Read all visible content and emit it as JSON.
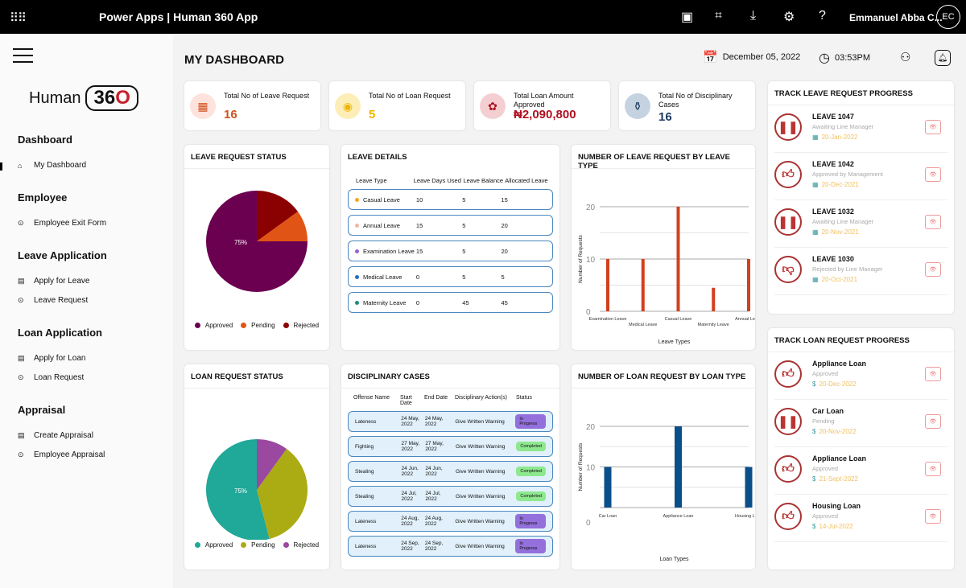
{
  "topbar": {
    "app_title": "Power Apps | Human 360 App",
    "user_name": "Emmanuel Abba C...",
    "avatar_initials": "EC",
    "icons": [
      "waffle-icon",
      "teams-icon",
      "fit-screen-icon",
      "download-icon",
      "settings-icon",
      "help-icon"
    ]
  },
  "sidebar": {
    "logo_text": "Human",
    "logo_badge": "36",
    "logo_badge_accent": "O",
    "sections": [
      {
        "title": "Dashboard",
        "items": [
          {
            "label": "My Dashboard",
            "icon": "home-icon"
          }
        ]
      },
      {
        "title": "Employee",
        "items": [
          {
            "label": "Employee Exit Form",
            "icon": "circle-dots-icon"
          }
        ]
      },
      {
        "title": "Leave Application",
        "items": [
          {
            "label": "Apply for Leave",
            "icon": "form-icon"
          },
          {
            "label": "Leave Request",
            "icon": "circle-dots-icon"
          }
        ]
      },
      {
        "title": "Loan Application",
        "items": [
          {
            "label": "Apply for Loan",
            "icon": "form-icon"
          },
          {
            "label": "Loan Request",
            "icon": "circle-dots-icon"
          }
        ]
      },
      {
        "title": "Appraisal",
        "items": [
          {
            "label": "Create Appraisal",
            "icon": "form-icon"
          },
          {
            "label": "Employee Appraisal",
            "icon": "circle-dots-icon"
          }
        ]
      }
    ]
  },
  "header": {
    "title": "MY DASHBOARD",
    "date": "December 05, 2022",
    "time": "03:53PM"
  },
  "kpis": [
    {
      "label": "Total No of Leave Request",
      "value": "16",
      "color": "#d2501e",
      "bg": "#fde3dc",
      "icon": "leave-icon"
    },
    {
      "label": "Total No of Loan Request",
      "value": "5",
      "color": "#f0b400",
      "bg": "#fdeeb8",
      "icon": "loan-icon"
    },
    {
      "label": "Total Loan Amount Approved",
      "value": "₦2,090,800",
      "color": "#b01020",
      "bg": "#f4cfd2",
      "icon": "money-icon"
    },
    {
      "label": "Total No of Disciplinary Cases",
      "value": "16",
      "color": "#1d3a5f",
      "bg": "#c5d3e0",
      "icon": "discipline-icon"
    }
  ],
  "leave_status": {
    "title": "LEAVE REQUEST STATUS"
  },
  "loan_status": {
    "title": "LOAN REQUEST STATUS"
  },
  "leave_details": {
    "title": "LEAVE DETAILS",
    "columns": [
      "Leave Type",
      "Leave Days Used",
      "Leave Balance",
      "Allocated Leave"
    ],
    "rows": [
      {
        "type": "Casual Leave",
        "used": "10",
        "balance": "5",
        "allocated": "15",
        "dot": "#f5a623"
      },
      {
        "type": "Annual Leave",
        "used": "15",
        "balance": "5",
        "allocated": "20",
        "dot": "#f2b8a0"
      },
      {
        "type": "Examination Leave",
        "used": "15",
        "balance": "5",
        "allocated": "20",
        "dot": "#9466d0"
      },
      {
        "type": "Medical Leave",
        "used": "0",
        "balance": "5",
        "allocated": "5",
        "dot": "#1f6fc0"
      },
      {
        "type": "Maternity Leave",
        "used": "0",
        "balance": "45",
        "allocated": "45",
        "dot": "#1e8a80"
      }
    ]
  },
  "disciplinary": {
    "title": "DISCIPLINARY CASES",
    "columns": [
      "Offense Name",
      "Start Date",
      "End Date",
      "Disciplinary Action(s)",
      "Status"
    ],
    "rows": [
      {
        "offense": "Lateness",
        "start": "24 May, 2022",
        "end": "24 May, 2022",
        "action": "Give Written Warning",
        "status": "In Progress"
      },
      {
        "offense": "Fighting",
        "start": "27 May, 2022",
        "end": "27 May, 2022",
        "action": "Give Written Warning",
        "status": "Completed"
      },
      {
        "offense": "Stealing",
        "start": "24 Jun, 2022",
        "end": "24 Jun, 2022",
        "action": "Give Written Warning",
        "status": "Completed"
      },
      {
        "offense": "Stealing",
        "start": "24 Jul, 2022",
        "end": "24 Jul, 2022",
        "action": "Give Written Warning",
        "status": "Completed"
      },
      {
        "offense": "Lateness",
        "start": "24 Aug, 2022",
        "end": "24 Aug, 2022",
        "action": "Give Written Warning",
        "status": "In Progress"
      },
      {
        "offense": "Lateness",
        "start": "24 Sep, 2022",
        "end": "24 Sep, 2022",
        "action": "Give Written Warning",
        "status": "In Progress"
      }
    ],
    "status_colors": {
      "In Progress": "#9370db",
      "Completed": "#8ee88e"
    }
  },
  "leave_track": {
    "title": "TRACK LEAVE REQUEST PROGRESS",
    "items": [
      {
        "name": "LEAVE 1047",
        "status": "Awaiting Line Manager",
        "date": "20-Jan-2022",
        "icon": "pause-icon"
      },
      {
        "name": "LEAVE 1042",
        "status": "Approved by Management",
        "date": "20-Dec-2021",
        "icon": "thumbs-up-icon"
      },
      {
        "name": "LEAVE 1032",
        "status": "Awaiting Line Manager",
        "date": "20-Nov-2021",
        "icon": "pause-icon"
      },
      {
        "name": "LEAVE 1030",
        "status": "Rejected by Line Manager",
        "date": "20-Oct-2021",
        "icon": "thumbs-down-icon"
      }
    ]
  },
  "loan_track": {
    "title": "TRACK LOAN REQUEST PROGRESS",
    "items": [
      {
        "name": "Appliance Loan",
        "status": "Approved",
        "date": "20-Dec-2022",
        "icon": "thumbs-up-icon"
      },
      {
        "name": "Car Loan",
        "status": "Pending",
        "date": "20-Nov-2022",
        "icon": "pause-icon"
      },
      {
        "name": "Appliance Loan",
        "status": "Approved",
        "date": "21-Sept-2022",
        "icon": "thumbs-up-icon"
      },
      {
        "name": "Housing Loan",
        "status": "Approved",
        "date": "14-Jul-2022",
        "icon": "thumbs-up-icon"
      }
    ]
  },
  "chart_data": [
    {
      "type": "pie",
      "title": "LEAVE REQUEST STATUS",
      "categories": [
        "Approved",
        "Pending",
        "Rejected"
      ],
      "values": [
        75,
        10,
        15
      ],
      "colors": [
        "#6b0050",
        "#e05515",
        "#8b0000"
      ],
      "slice_label": "75%",
      "legend": "bottom"
    },
    {
      "type": "pie",
      "title": "LOAN REQUEST STATUS",
      "categories": [
        "Approved",
        "Pending",
        "Rejected"
      ],
      "values": [
        54,
        36,
        10
      ],
      "colors": [
        "#20a898",
        "#abab14",
        "#9a48a0"
      ],
      "slice_label": "75%",
      "legend": "bottom"
    },
    {
      "type": "bar",
      "title": "NUMBER OF LEAVE REQUEST BY LEAVE TYPE",
      "categories": [
        "Examination Leave",
        "Medical Leave",
        "Casual Leave",
        "Maternity Leave",
        "Annual Leave"
      ],
      "values": [
        10,
        10,
        20,
        4.5,
        10
      ],
      "xlabel": "Leave Types",
      "ylabel": "Number of Requests",
      "ylim": [
        0,
        20
      ],
      "yticks": [
        "0",
        "10",
        "20"
      ],
      "color": "#d2401e",
      "grid": true
    },
    {
      "type": "bar",
      "title": "NUMBER OF LOAN REQUEST BY LOAN TYPE",
      "categories": [
        "Car Loan",
        "Appliance Loan",
        "Housing Loan"
      ],
      "values": [
        10,
        20,
        10
      ],
      "xlabel": "Loan Types",
      "ylabel": "Number of Requests",
      "ylim": [
        0,
        20
      ],
      "yticks": [
        "0",
        "10",
        "20"
      ],
      "color": "#0b4f8a",
      "grid": true
    }
  ]
}
